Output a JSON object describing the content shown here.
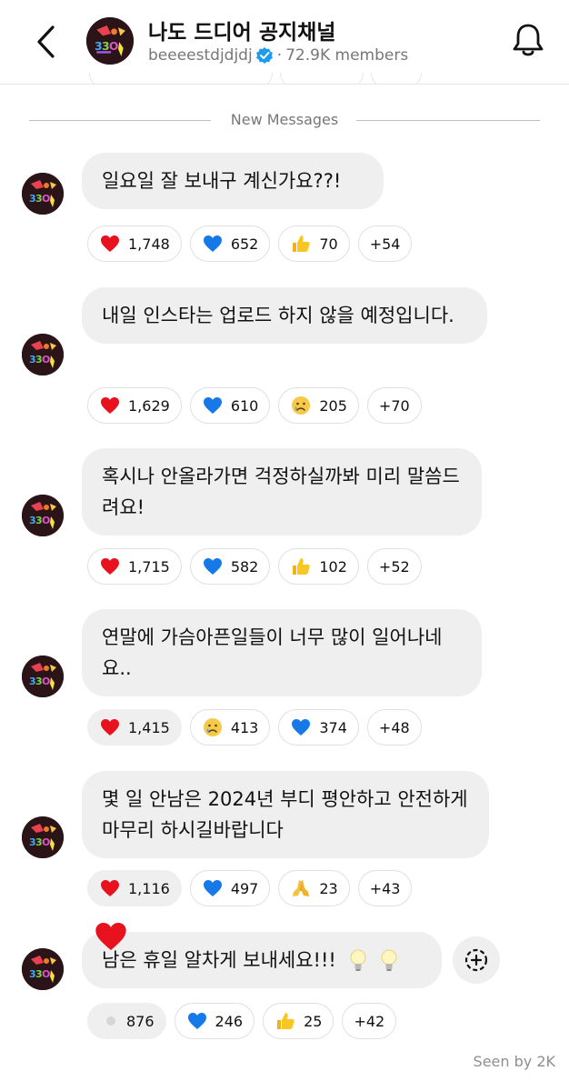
{
  "header": {
    "title": "나도 드디어 공지채널",
    "username": "beeeestdjdjdj",
    "members": "72.9K members"
  },
  "divider": {
    "label": "New Messages"
  },
  "messages": [
    {
      "text": "일요일 잘 보내구 계신가요??!",
      "reactions": [
        {
          "icon": "red-heart-icon",
          "count": "1,748"
        },
        {
          "icon": "blue-heart-icon",
          "count": "652"
        },
        {
          "icon": "thumbs-up-icon",
          "count": "70"
        }
      ],
      "more": "+54"
    },
    {
      "text": "내일 인스타는 업로드 하지 않을 예정입니다.",
      "reactions": [
        {
          "icon": "red-heart-icon",
          "count": "1,629"
        },
        {
          "icon": "blue-heart-icon",
          "count": "610"
        },
        {
          "icon": "crying-face-icon",
          "count": "205"
        }
      ],
      "more": "+70"
    },
    {
      "text": "혹시나 안올라가면 걱정하실까봐 미리 말씀드려요!",
      "reactions": [
        {
          "icon": "red-heart-icon",
          "count": "1,715"
        },
        {
          "icon": "blue-heart-icon",
          "count": "582"
        },
        {
          "icon": "thumbs-up-icon",
          "count": "102"
        }
      ],
      "more": "+52"
    },
    {
      "text": "연말에 가슴아픈일들이 너무 많이 일어나네요..",
      "reactions": [
        {
          "icon": "red-heart-icon",
          "count": "1,415"
        },
        {
          "icon": "crying-face-icon",
          "count": "413"
        },
        {
          "icon": "blue-heart-icon",
          "count": "374"
        }
      ],
      "more": "+48"
    },
    {
      "text": "몇 일 안남은 2024년 부디 평안하고 안전하게 마무리 하시길바랍니다",
      "reactions": [
        {
          "icon": "red-heart-icon",
          "count": "1,116"
        },
        {
          "icon": "blue-heart-icon",
          "count": "497"
        },
        {
          "icon": "folded-hands-icon",
          "count": "23"
        }
      ],
      "more": "+43"
    },
    {
      "text": "남은 휴일 알차게 보내세요!!!",
      "reactions": [
        {
          "icon": "gray-dot",
          "count": "876"
        },
        {
          "icon": "blue-heart-icon",
          "count": "246"
        },
        {
          "icon": "thumbs-up-icon",
          "count": "25"
        }
      ],
      "more": "+42"
    }
  ],
  "footer": {
    "seen": "Seen by 2K"
  },
  "colors": {
    "accent_blue": "#1d9bf0",
    "bubble_gray": "#efefef",
    "heart_red": "#e8111e"
  }
}
